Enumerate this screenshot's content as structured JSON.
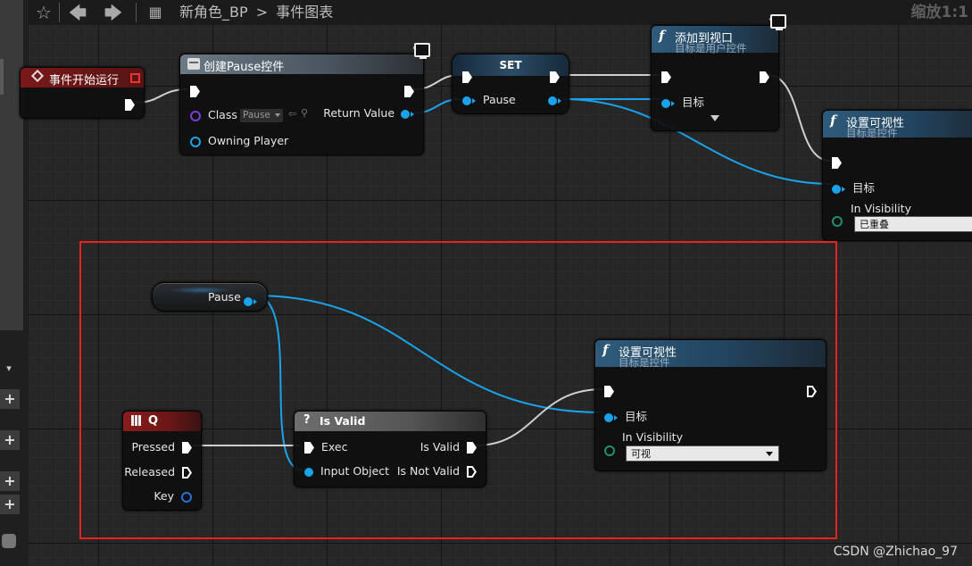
{
  "toolbar": {
    "breadcrumb_blueprint": "新角色_BP",
    "breadcrumb_separator": ">",
    "breadcrumb_graph": "事件图表",
    "zoom": "缩放1:1"
  },
  "nodes": {
    "begin_play": {
      "title": "事件开始运行"
    },
    "create_widget": {
      "title": "创建Pause控件",
      "class_label": "Class",
      "class_value": "Pause",
      "return_value": "Return Value",
      "owning_player": "Owning Player"
    },
    "set_node": {
      "title": "SET",
      "pin": "Pause"
    },
    "add_to_viewport": {
      "title": "添加到视口",
      "subtitle": "目标是用户控件",
      "target": "目标"
    },
    "set_visibility_top": {
      "title": "设置可视性",
      "subtitle": "目标是控件",
      "target": "目标",
      "in_visibility": "In Visibility",
      "dropdown_value": "已重叠"
    },
    "pause_var": {
      "label": "Pause"
    },
    "key_q": {
      "title": "Q",
      "pressed": "Pressed",
      "released": "Released",
      "key": "Key"
    },
    "is_valid": {
      "title": "Is Valid",
      "exec": "Exec",
      "input_object": "Input Object",
      "is_valid_out": "Is Valid",
      "is_not_valid": "Is Not Valid"
    },
    "set_visibility_bottom": {
      "title": "设置可视性",
      "subtitle": "目标是控件",
      "target": "目标",
      "in_visibility": "In Visibility",
      "dropdown_value": "可视"
    }
  },
  "watermark": "CSDN @Zhichao_97",
  "colors": {
    "object_pin": "#1aa3ea",
    "exec_wire": "#d0d0d0",
    "highlight_box": "#e8231e",
    "graph_bg": "#262626"
  }
}
